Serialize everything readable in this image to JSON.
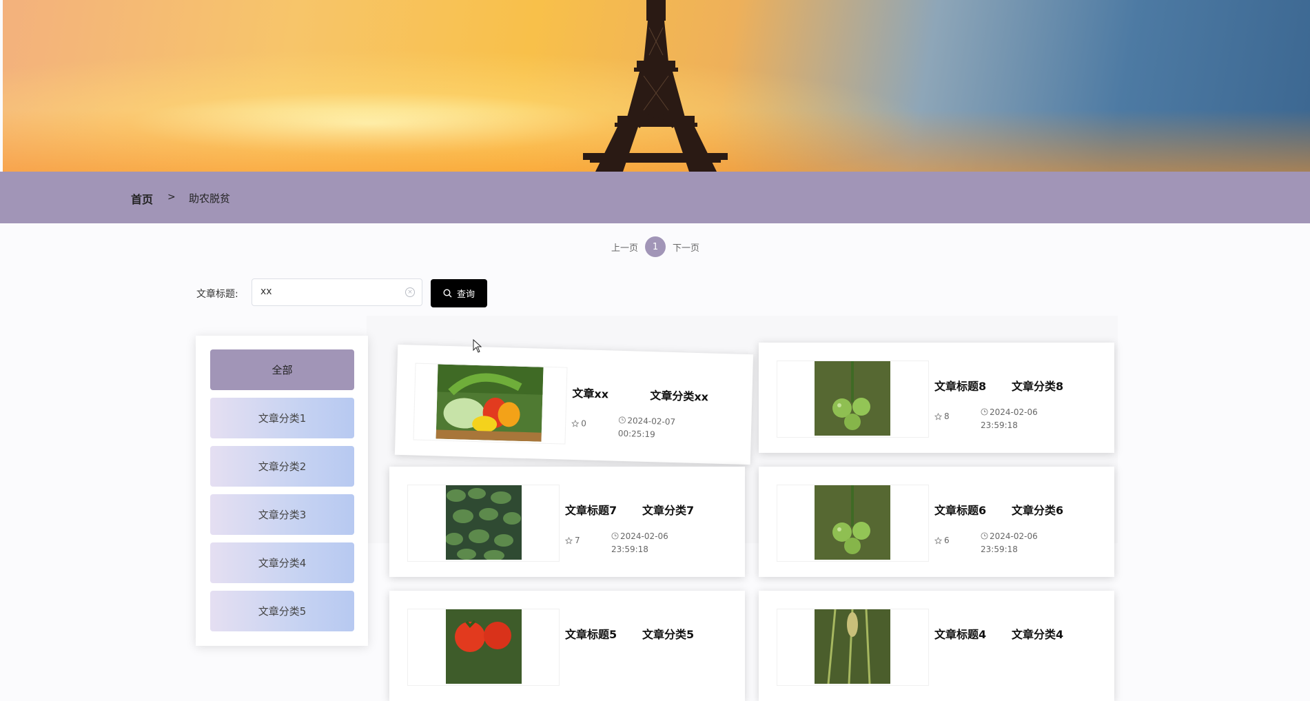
{
  "breadcrumb": {
    "home": "首页",
    "separator": ">",
    "current": "助农脱贫"
  },
  "pagination": {
    "prev": "上一页",
    "current": "1",
    "next": "下一页"
  },
  "search": {
    "label": "文章标题:",
    "value": "xx",
    "button": "查询"
  },
  "categories": [
    "全部",
    "文章分类1",
    "文章分类2",
    "文章分类3",
    "文章分类4",
    "文章分类5"
  ],
  "articles": [
    {
      "title": "文章xx",
      "category": "文章分类xx",
      "likes": "0",
      "time": "2024-02-07 00:25:19",
      "image": "mixed-vegetables-basket"
    },
    {
      "title": "文章标题8",
      "category": "文章分类8",
      "likes": "8",
      "time": "2024-02-06 23:59:18",
      "image": "green-tomatoes-on-vine"
    },
    {
      "title": "文章标题7",
      "category": "文章分类7",
      "likes": "7",
      "time": "2024-02-06 23:59:18",
      "image": "leafy-crop-field"
    },
    {
      "title": "文章标题6",
      "category": "文章分类6",
      "likes": "6",
      "time": "2024-02-06 23:59:18",
      "image": "green-tomatoes-on-vine"
    },
    {
      "title": "文章标题5",
      "category": "文章分类5",
      "likes": "",
      "time": "",
      "image": "red-tomatoes"
    },
    {
      "title": "文章标题4",
      "category": "文章分类4",
      "likes": "",
      "time": "",
      "image": "crop-stalks"
    }
  ],
  "colors": {
    "accent": "#a195b7",
    "button": "#000000"
  }
}
